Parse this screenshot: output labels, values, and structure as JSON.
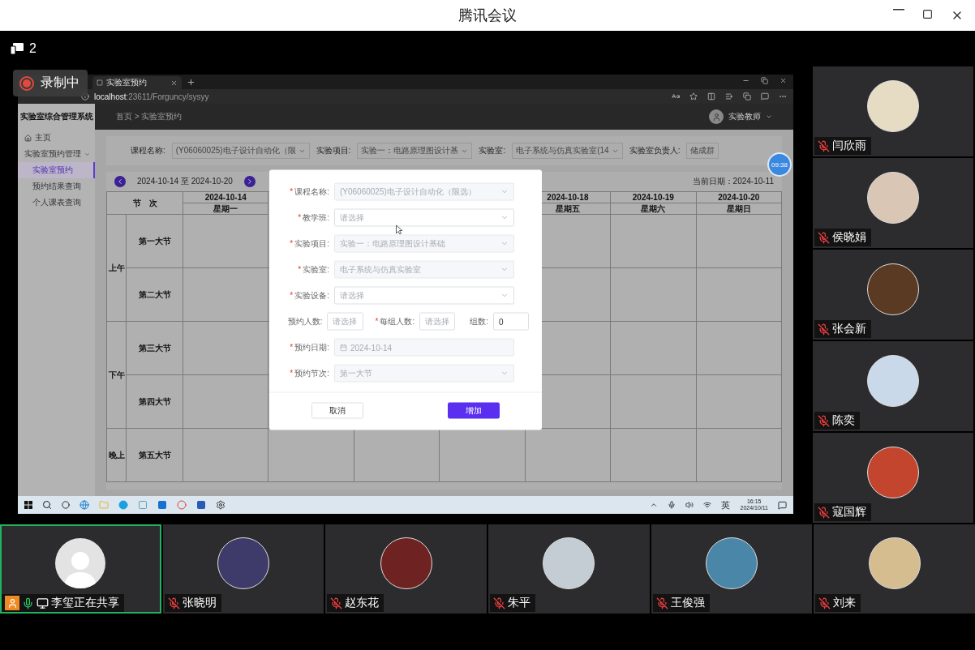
{
  "window": {
    "title": "腾讯会议"
  },
  "meeting_bar": {
    "participant_count": "2"
  },
  "recording": {
    "label": "录制中"
  },
  "shared_screen": {
    "browser": {
      "tab_title": "实验室预约",
      "url_host": "localhost",
      "url_path": ":23611/Forguncy/sysyy"
    },
    "app": {
      "title": "实验室综合管理系统",
      "breadcrumb": "首页 > 实验室预约",
      "user": "实验教师",
      "sidebar": [
        {
          "label": "主页",
          "selected": false
        },
        {
          "label": "实验室预约管理",
          "selected": false,
          "expanded": true,
          "children": [
            {
              "label": "实验室预约",
              "selected": true
            },
            {
              "label": "预约结果查询",
              "selected": false
            },
            {
              "label": "个人课表查询",
              "selected": false
            }
          ]
        }
      ],
      "filters": [
        {
          "label": "课程名称:",
          "value": "(Y06060025)电子设计自动化（限",
          "kind": "select"
        },
        {
          "label": "实验项目:",
          "value": "实验一：电路原理图设计基",
          "kind": "select"
        },
        {
          "label": "实验室:",
          "value": "电子系统与仿真实验室(14",
          "kind": "select"
        },
        {
          "label": "实验室负责人:",
          "value": "储成群",
          "kind": "text"
        }
      ],
      "timer": "09:38",
      "week": {
        "range": "2024-10-14 至 2024-10-20",
        "current_date": "当前日期：2024-10-11"
      },
      "calendar": {
        "period_header": "节　次",
        "days": [
          {
            "date": "2024-10-14",
            "weekday": "星期一"
          },
          {
            "date": "2024-10-18",
            "weekday": "星期五"
          },
          {
            "date": "2024-10-19",
            "weekday": "星期六"
          },
          {
            "date": "2024-10-20",
            "weekday": "星期日"
          }
        ],
        "sections": [
          {
            "label": "上午",
            "slots": [
              "第一大节",
              "第二大节"
            ]
          },
          {
            "label": "下午",
            "slots": [
              "第三大节",
              "第四大节"
            ]
          },
          {
            "label": "晚上",
            "slots": [
              "第五大节"
            ]
          }
        ]
      },
      "dialog": {
        "required_mark": "*",
        "fields": [
          {
            "kind": "select",
            "label": "课程名称:",
            "required": true,
            "disabled": true,
            "value": "(Y06060025)电子设计自动化（限选）"
          },
          {
            "kind": "select",
            "label": "教学班:",
            "required": true,
            "disabled": false,
            "placeholder": "请选择"
          },
          {
            "kind": "select",
            "label": "实验项目:",
            "required": true,
            "disabled": true,
            "value": "实验一：电路原理图设计基础"
          },
          {
            "kind": "select",
            "label": "实验室:",
            "required": true,
            "disabled": true,
            "value": "电子系统与仿真实验室"
          },
          {
            "kind": "select",
            "label": "实验设备:",
            "required": true,
            "disabled": false,
            "placeholder": "请选择"
          },
          {
            "kind": "inline",
            "items": [
              {
                "label": "预约人数:",
                "required": false,
                "placeholder": "请选择"
              },
              {
                "label": "每组人数:",
                "required": true,
                "placeholder": "请选择"
              },
              {
                "label": "组数:",
                "required": false,
                "value": "0"
              }
            ]
          },
          {
            "kind": "date",
            "label": "预约日期:",
            "required": true,
            "disabled": true,
            "value": "2024-10-14"
          },
          {
            "kind": "select",
            "label": "预约节次:",
            "required": true,
            "disabled": true,
            "value": "第一大节"
          }
        ],
        "buttons": [
          {
            "label": "取消",
            "kind": "secondary"
          },
          {
            "label": "增加",
            "kind": "primary"
          }
        ]
      }
    },
    "taskbar": {
      "ime": "英",
      "time": "16:15",
      "date": "2024/10/11"
    }
  },
  "participants_side": [
    {
      "name": "闫欣雨",
      "mic_on": false,
      "host": false,
      "sharing": false,
      "has_photo": true
    },
    {
      "name": "侯晓娟",
      "mic_on": false,
      "host": false,
      "sharing": false,
      "has_photo": true
    },
    {
      "name": "张会新",
      "mic_on": false,
      "host": false,
      "sharing": false,
      "has_photo": true
    },
    {
      "name": "陈奕",
      "mic_on": false,
      "host": false,
      "sharing": false,
      "has_photo": true
    },
    {
      "name": "寇国辉",
      "mic_on": false,
      "host": false,
      "sharing": false,
      "has_photo": true
    }
  ],
  "participants_bottom": [
    {
      "name": "李玺正在共享",
      "mic_on": true,
      "host": true,
      "sharing": true,
      "has_photo": false
    },
    {
      "name": "张晓明",
      "mic_on": false,
      "host": false,
      "sharing": false,
      "has_photo": true
    },
    {
      "name": "赵东花",
      "mic_on": false,
      "host": false,
      "sharing": false,
      "has_photo": true
    },
    {
      "name": "朱平",
      "mic_on": false,
      "host": false,
      "sharing": false,
      "has_photo": true
    },
    {
      "name": "王俊强",
      "mic_on": false,
      "host": false,
      "sharing": false,
      "has_photo": true
    },
    {
      "name": "刘来",
      "mic_on": false,
      "host": false,
      "sharing": false,
      "has_photo": true
    }
  ]
}
